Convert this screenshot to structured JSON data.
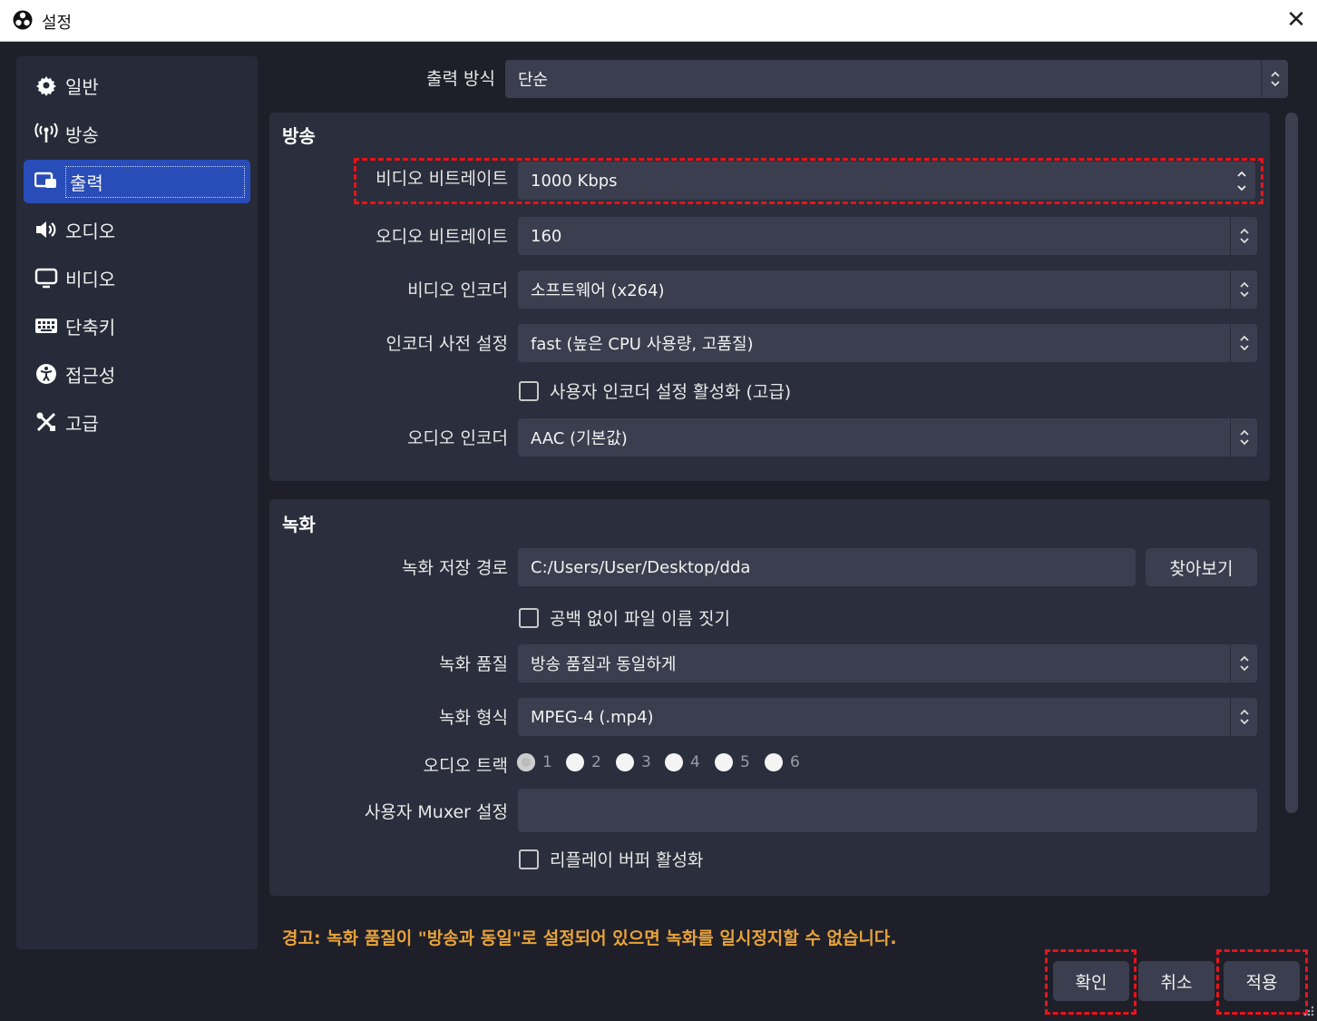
{
  "window": {
    "title": "설정",
    "close": "✕"
  },
  "sidebar": {
    "items": [
      {
        "label": "일반",
        "icon": "gear-icon"
      },
      {
        "label": "방송",
        "icon": "antenna-icon"
      },
      {
        "label": "출력",
        "icon": "output-icon"
      },
      {
        "label": "오디오",
        "icon": "speaker-icon"
      },
      {
        "label": "비디오",
        "icon": "monitor-icon"
      },
      {
        "label": "단축키",
        "icon": "keyboard-icon"
      },
      {
        "label": "접근성",
        "icon": "accessibility-icon"
      },
      {
        "label": "고급",
        "icon": "tools-icon"
      }
    ],
    "active_index": 2
  },
  "output_mode": {
    "label": "출력 방식",
    "value": "단순"
  },
  "streaming": {
    "title": "방송",
    "video_bitrate": {
      "label": "비디오 비트레이트",
      "value": "1000 Kbps"
    },
    "audio_bitrate": {
      "label": "오디오 비트레이트",
      "value": "160"
    },
    "video_encoder": {
      "label": "비디오 인코더",
      "value": "소프트웨어 (x264)"
    },
    "encoder_preset": {
      "label": "인코더 사전 설정",
      "value": "fast (높은 CPU 사용량, 고품질)"
    },
    "custom_encoder": {
      "label": "사용자 인코더 설정 활성화 (고급)",
      "checked": false
    },
    "audio_encoder": {
      "label": "오디오 인코더",
      "value": "AAC (기본값)"
    }
  },
  "recording": {
    "title": "녹화",
    "path": {
      "label": "녹화 저장 경로",
      "value": "C:/Users/User/Desktop/dda",
      "browse": "찾아보기"
    },
    "no_space": {
      "label": "공백 없이 파일 이름 짓기",
      "checked": false
    },
    "quality": {
      "label": "녹화 품질",
      "value": "방송 품질과 동일하게"
    },
    "format": {
      "label": "녹화 형식",
      "value": "MPEG-4 (.mp4)"
    },
    "audio_track": {
      "label": "오디오 트랙",
      "tracks": [
        "1",
        "2",
        "3",
        "4",
        "5",
        "6"
      ],
      "selected": "1"
    },
    "muxer": {
      "label": "사용자 Muxer 설정",
      "value": ""
    },
    "replay_buffer": {
      "label": "리플레이 버퍼 활성화",
      "checked": false
    }
  },
  "warning": "경고: 녹화 품질이 \"방송과 동일\"로 설정되어 있으면 녹화를 일시정지할 수 없습니다.",
  "buttons": {
    "ok": "확인",
    "cancel": "취소",
    "apply": "적용"
  },
  "colors": {
    "accent": "#284cb8",
    "warning": "#e8a33a",
    "highlight": "#e8141a",
    "panel": "#2b2e3c",
    "background": "#1e1f29"
  }
}
